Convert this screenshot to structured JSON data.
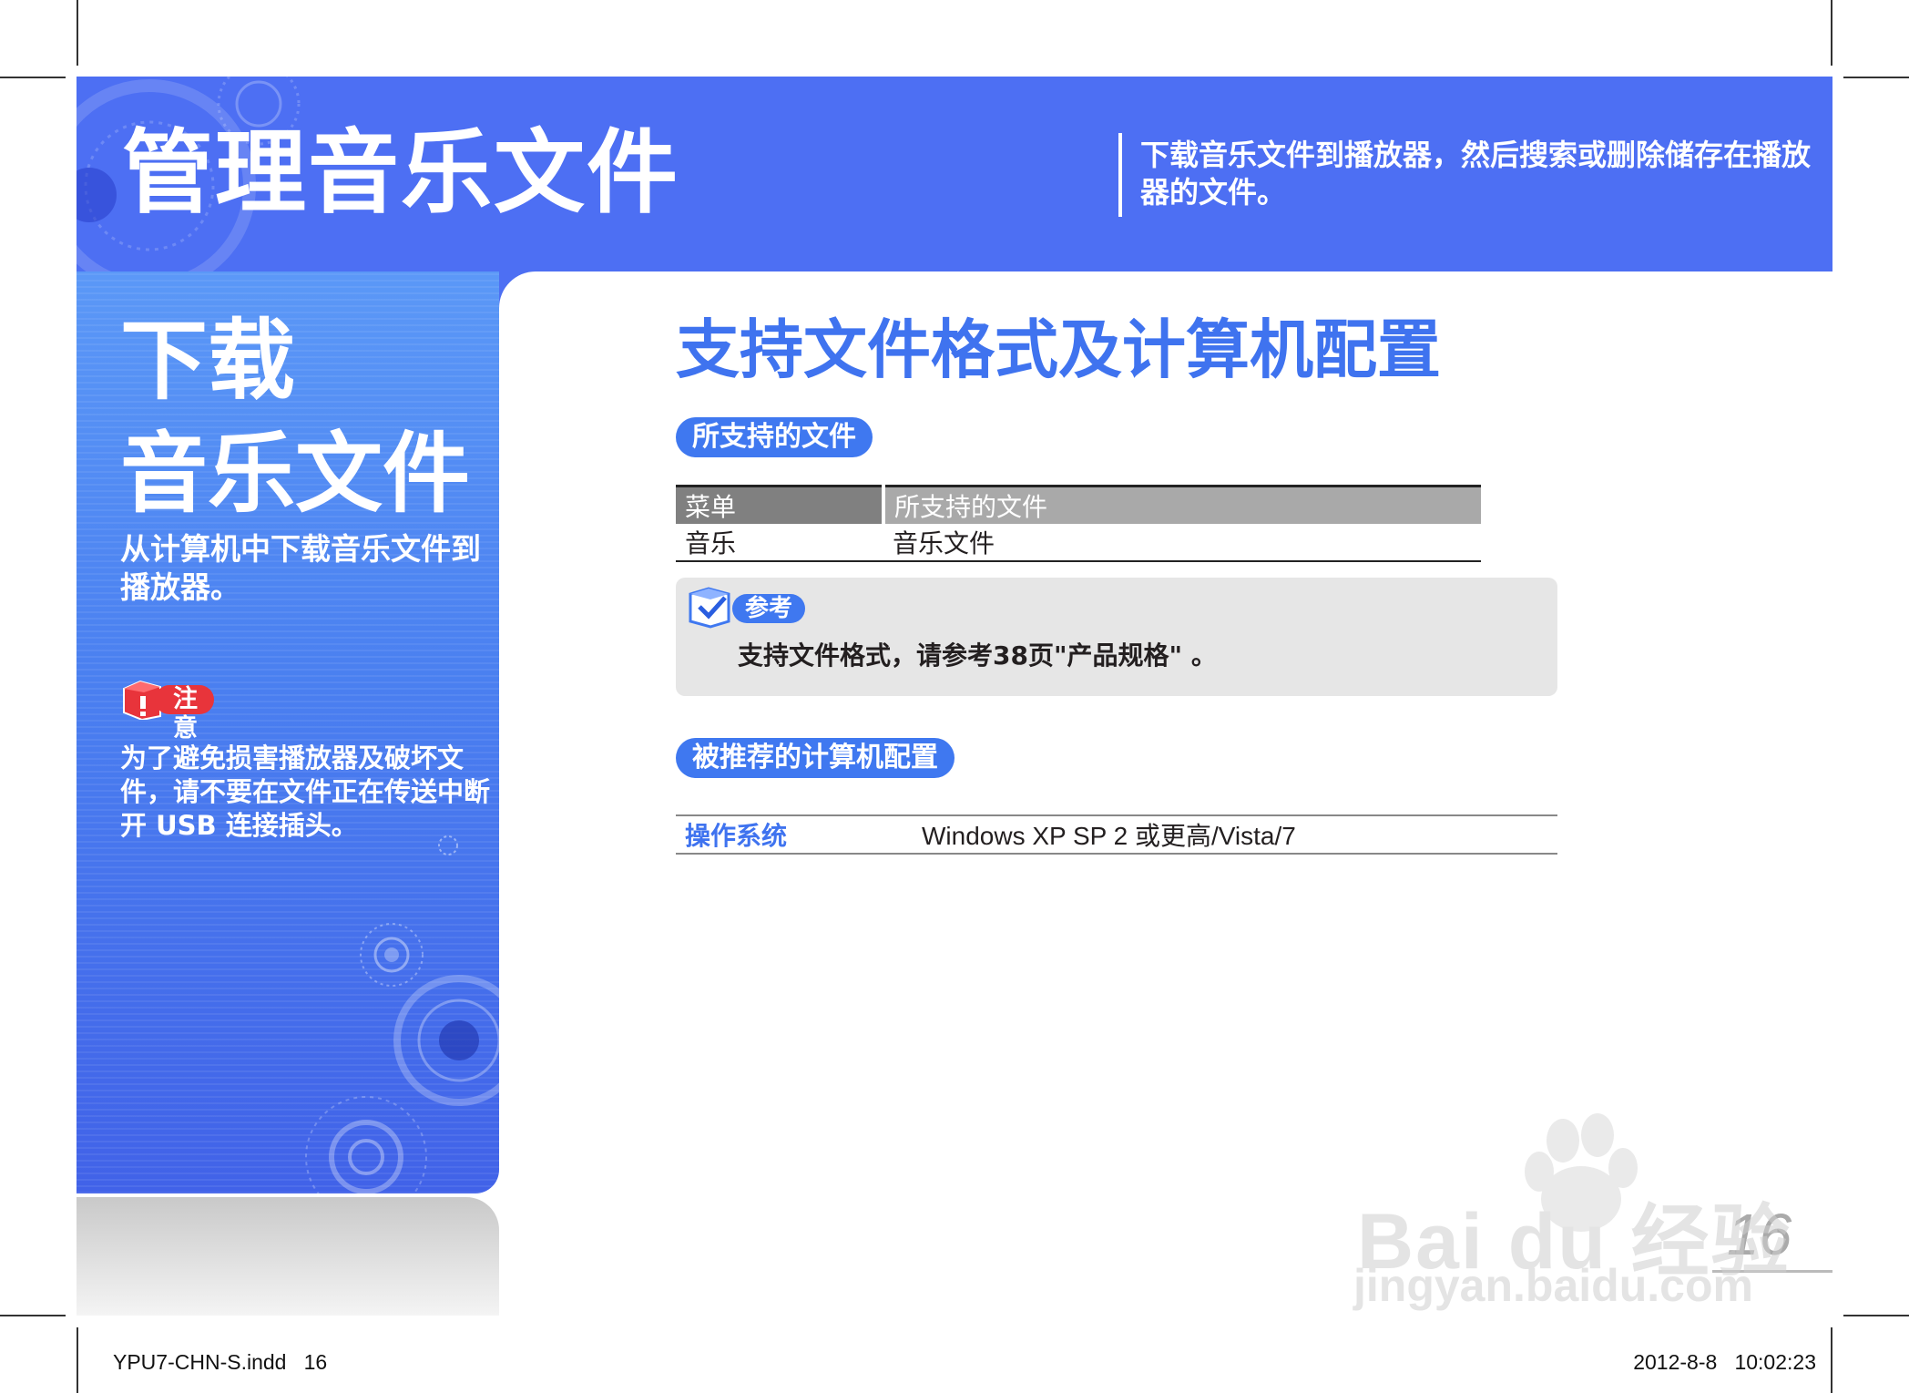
{
  "header": {
    "title": "管理音乐文件",
    "description": "下载音乐文件到播放器，然后搜索或删除储存在播放器的文件。"
  },
  "sidebar": {
    "heading_line1": "下载",
    "heading_line2": "音乐文件",
    "intro": "从计算机中下载音乐文件到播放器。",
    "caution_label": "注意",
    "caution_text": "为了避免损害播放器及破坏文件，请不要在文件正在传送中断开 USB 连接插头。"
  },
  "main": {
    "title": "支持文件格式及计算机配置",
    "supported_section_label": "所支持的文件",
    "files_table": {
      "headers": [
        "菜单",
        "所支持的文件"
      ],
      "rows": [
        [
          "音乐",
          "音乐文件"
        ]
      ]
    },
    "note": {
      "label": "参考",
      "text": "支持文件格式，请参考38页\"产品规格\" 。"
    },
    "recommended_section_label": "被推荐的计算机配置",
    "config": {
      "key": "操作系统",
      "value": "Windows XP SP 2 或更高/Vista/7"
    }
  },
  "page_number": "16",
  "watermark": {
    "line1": "Bai du 经验",
    "line2": "jingyan.baidu.com"
  },
  "footer": {
    "left": "YPU7-CHN-S.indd   16",
    "right": "2012-8-8   10:02:23"
  },
  "colors": {
    "header_blue": "#4d6ff3",
    "accent_blue": "#3f78f0",
    "caution_red": "#e8343b",
    "note_gray": "#e6e6e6"
  }
}
